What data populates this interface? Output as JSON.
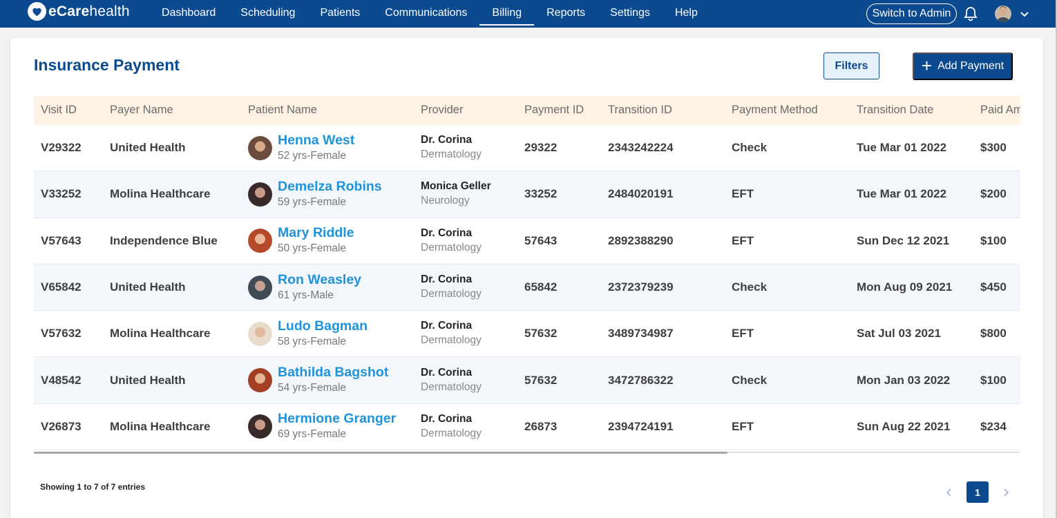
{
  "brand": {
    "name_bold": "eCare",
    "name_rest": "health"
  },
  "nav": [
    "Dashboard",
    "Scheduling",
    "Patients",
    "Communications",
    "Billing",
    "Reports",
    "Settings",
    "Help"
  ],
  "nav_active": "Billing",
  "admin_label": "Switch to Admin",
  "page": {
    "title": "Insurance Payment",
    "filters_label": "Filters",
    "add_label": "Add Payment"
  },
  "columns": [
    "Visit ID",
    "Payer Name",
    "Patient Name",
    "Provider",
    "Payment ID",
    "Transition ID",
    "Payment Method",
    "Transition Date",
    "Paid Amount"
  ],
  "rows": [
    {
      "visit": "V29322",
      "payer": "United Health",
      "patient": "Henna West",
      "patient_info": "52 yrs-Female",
      "provider": "Dr. Corina",
      "specialty": "Dermatology",
      "payment_id": "29322",
      "transition_id": "2343242224",
      "method": "Check",
      "date": "Tue Mar 01 2022",
      "amount": "$300",
      "photo_bg": "#6b4b3c",
      "photo_fg": "#d9a98a"
    },
    {
      "visit": "V33252",
      "payer": "Molina Healthcare",
      "patient": "Demelza Robins",
      "patient_info": "59 yrs-Female",
      "provider": "Monica Geller",
      "specialty": "Neurology",
      "payment_id": "33252",
      "transition_id": "2484020191",
      "method": "EFT",
      "date": "Tue Mar 01 2022",
      "amount": "$200",
      "photo_bg": "#3a2a2a",
      "photo_fg": "#c99a88"
    },
    {
      "visit": "V57643",
      "payer": "Independence Blue",
      "patient": "Mary Riddle",
      "patient_info": "50 yrs-Female",
      "provider": "Dr. Corina",
      "specialty": "Dermatology",
      "payment_id": "57643",
      "transition_id": "2892388290",
      "method": "EFT",
      "date": "Sun Dec 12 2021",
      "amount": "$100",
      "photo_bg": "#b54a2a",
      "photo_fg": "#e8b89a"
    },
    {
      "visit": "V65842",
      "payer": "United Health",
      "patient": "Ron Weasley",
      "patient_info": "61 yrs-Male",
      "provider": "Dr. Corina",
      "specialty": "Dermatology",
      "payment_id": "65842",
      "transition_id": "2372379239",
      "method": "Check",
      "date": "Mon Aug 09 2021",
      "amount": "$450",
      "photo_bg": "#3f4b55",
      "photo_fg": "#c7a290"
    },
    {
      "visit": "V57632",
      "payer": "Molina Healthcare",
      "patient": "Ludo Bagman",
      "patient_info": "58 yrs-Female",
      "provider": "Dr. Corina",
      "specialty": "Dermatology",
      "payment_id": "57632",
      "transition_id": "3489734987",
      "method": "EFT",
      "date": "Sat Jul 03 2021",
      "amount": "$800",
      "photo_bg": "#e9dccb",
      "photo_fg": "#e2b89e"
    },
    {
      "visit": "V48542",
      "payer": "United Health",
      "patient": "Bathilda Bagshot",
      "patient_info": "54 yrs-Female",
      "provider": "Dr. Corina",
      "specialty": "Dermatology",
      "payment_id": "57632",
      "transition_id": "3472786322",
      "method": "Check",
      "date": "Mon Jan 03 2022",
      "amount": "$100",
      "photo_bg": "#a23f25",
      "photo_fg": "#e6b496"
    },
    {
      "visit": "V26873",
      "payer": "Molina Healthcare",
      "patient": "Hermione Granger",
      "patient_info": "69 yrs-Female",
      "provider": "Dr. Corina",
      "specialty": "Dermatology",
      "payment_id": "26873",
      "transition_id": "2394724191",
      "method": "EFT",
      "date": "Sun Aug 22 2021",
      "amount": "$234",
      "photo_bg": "#3a2a2a",
      "photo_fg": "#c99a88"
    }
  ],
  "footer": {
    "entries": "Showing 1 to 7 of 7 entries",
    "page": "1"
  },
  "colors": {
    "primary": "#0b4a8f",
    "link": "#1f93db",
    "header_bg": "#fdf2e4",
    "row_alt": "#f3f7fc"
  },
  "icons": {
    "bell": "bell-icon",
    "chevron": "chevron-down-icon",
    "plus": "plus-icon",
    "prev": "chevron-left-icon",
    "next": "chevron-right-icon"
  }
}
